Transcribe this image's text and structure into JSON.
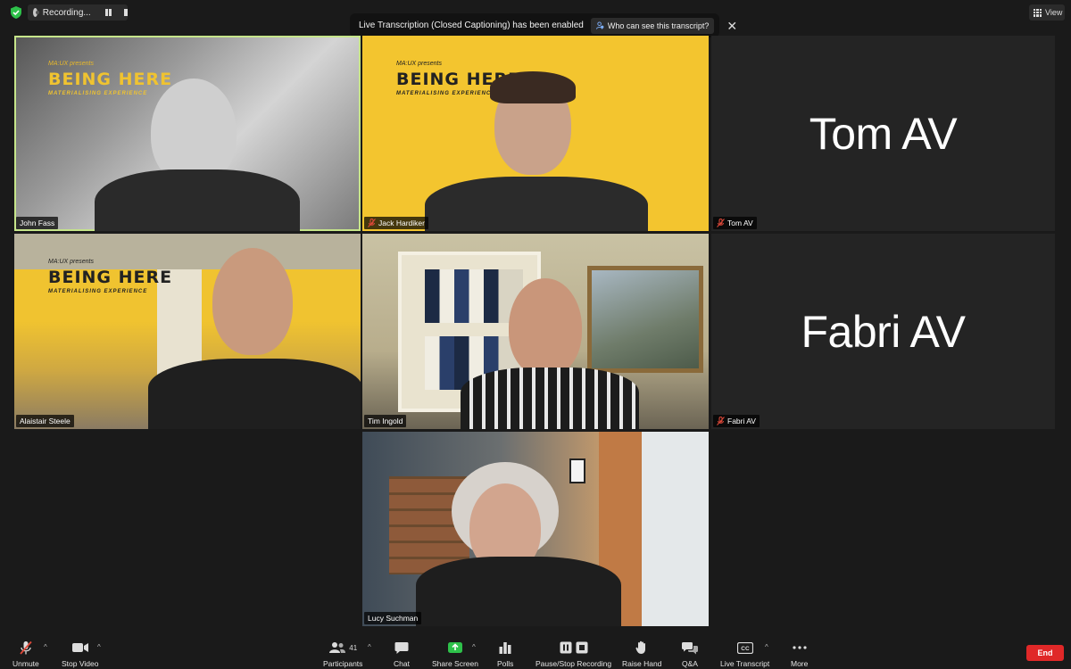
{
  "top_bar": {
    "recording_label": "Recording...",
    "notification": "Live Transcription (Closed Captioning) has been enabled",
    "notification_button": "Who can see this transcript?",
    "view_label": "View"
  },
  "overlay": {
    "presents": "MA:UX presents",
    "title": "BEING HERE",
    "subtitle": "MATERIALISING EXPERIENCE"
  },
  "participants": [
    {
      "name": "John Fass",
      "muted": false
    },
    {
      "name": "Jack Hardiker",
      "muted": true
    },
    {
      "name": "Tom AV",
      "muted": true,
      "avatar_text": "Tom AV"
    },
    {
      "name": "Alaistair Steele",
      "muted": false
    },
    {
      "name": "Tim Ingold",
      "muted": false
    },
    {
      "name": "Fabri AV",
      "muted": true,
      "avatar_text": "Fabri AV"
    },
    {
      "name": "Lucy Suchman",
      "muted": false
    }
  ],
  "toolbar": {
    "unmute": "Unmute",
    "stop_video": "Stop Video",
    "participants": "Participants",
    "participants_count": "41",
    "chat": "Chat",
    "share_screen": "Share Screen",
    "polls": "Polls",
    "pause_stop_recording": "Pause/Stop Recording",
    "raise_hand": "Raise Hand",
    "qa": "Q&A",
    "live_transcript": "Live Transcript",
    "more": "More",
    "end": "End"
  },
  "colors": {
    "active_speaker_outline": "#c6e58a",
    "share_screen_green": "#2ec14a",
    "end_red": "#e02828",
    "muted_red": "#e0493a"
  }
}
